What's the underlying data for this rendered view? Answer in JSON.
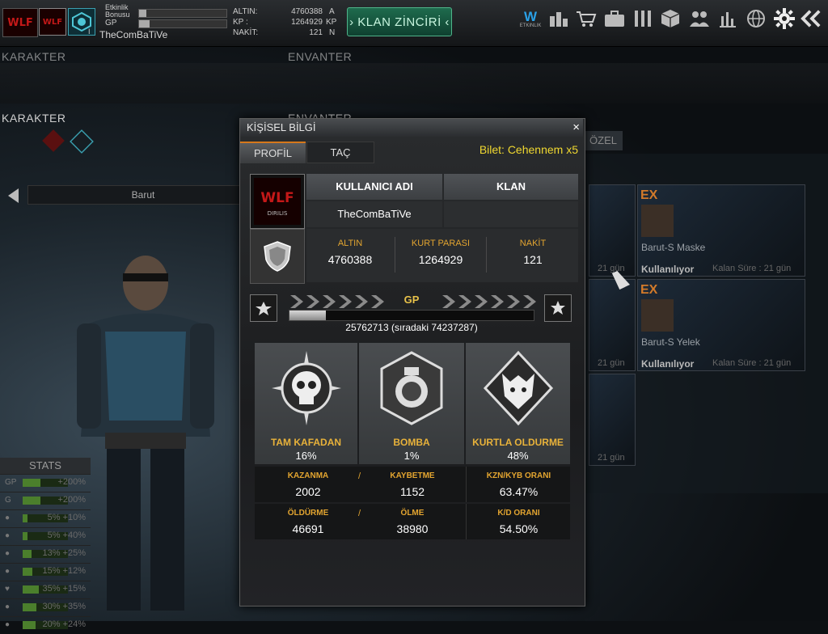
{
  "top": {
    "event_bonus_label": "Etkinlik Bonusu",
    "gp_label": "GP",
    "username": "TheComBaTiVe",
    "rank_suffix": "I",
    "currency": [
      {
        "label": "ALTIN:",
        "value": "4760388",
        "unit": "A"
      },
      {
        "label": "KP :",
        "value": "1264929",
        "unit": "KP"
      },
      {
        "label": "NAKİT:",
        "value": "121",
        "unit": "N"
      }
    ],
    "clan_chain_button": "› KLAN ZİNCİRİ ‹",
    "etkinlik_label": "ETKINLIK"
  },
  "ghost": {
    "section_left": "KARAKTER",
    "section_right": "ENVANTER"
  },
  "left": {
    "section_title": "KARAKTER",
    "selected_item": "Barut",
    "stats_title": "STATS",
    "stats": [
      {
        "label": "GP",
        "value": "+200%"
      },
      {
        "label": "G",
        "value": "+200%"
      },
      {
        "value": "5%   +10%"
      },
      {
        "value": "5%   +40%"
      },
      {
        "value": "13% +25%"
      },
      {
        "value": "15% +12%"
      },
      {
        "value": "35% +15%"
      },
      {
        "value": "30% +35%"
      },
      {
        "value": "20% +24%"
      }
    ]
  },
  "right": {
    "section_title": "ENVANTER",
    "tab_ozel": "ÖZEL",
    "items": [
      {
        "tag": "EX",
        "name": "Barut-S Maske",
        "status": "Kullanılıyor",
        "remaining": "Kalan Süre : 21 gün"
      },
      {
        "tag": "EX",
        "name": "Barut-S Yelek",
        "status": "Kullanılıyor",
        "remaining": "Kalan Süre : 21 gün"
      }
    ],
    "side_remaining": [
      "21 gün",
      "21 gün",
      "21 gün"
    ]
  },
  "dialog": {
    "title": "KİŞİSEL BİLGİ",
    "close": "×",
    "tabs": [
      "PROFİL",
      "TAÇ"
    ],
    "ticket": "Bilet: Cehennem x5",
    "headers": {
      "username": "KULLANICI ADI",
      "clan": "KLAN"
    },
    "username": "TheComBaTiVe",
    "clan": "",
    "money": [
      {
        "label": "ALTIN",
        "value": "4760388"
      },
      {
        "label": "KURT PARASI",
        "value": "1264929"
      },
      {
        "label": "NAKİT",
        "value": "121"
      }
    ],
    "gp_label": "GP",
    "gp_progress": 0.15,
    "gp_text": "25762713 (sıradaki 74237287)",
    "medals": [
      {
        "name": "TAM KAFADAN",
        "value": "16%"
      },
      {
        "name": "BOMBA",
        "value": "1%"
      },
      {
        "name": "KURTLA OLDURME",
        "value": "48%"
      }
    ],
    "row1": {
      "win_label": "KAZANMA",
      "win": "2002",
      "loss_label": "KAYBETME",
      "loss": "1152",
      "ratio_label": "KZN/KYB ORANI",
      "ratio": "63.47%"
    },
    "row2": {
      "kill_label": "ÖLDÜRME",
      "kill": "46691",
      "death_label": "ÖLME",
      "death": "38980",
      "ratio_label": "K/D ORANI",
      "ratio": "54.50%"
    }
  },
  "colors": {
    "accent_orange": "#e3a530",
    "ticket_yellow": "#f0d830",
    "clan_green": "#1e6b4d"
  }
}
